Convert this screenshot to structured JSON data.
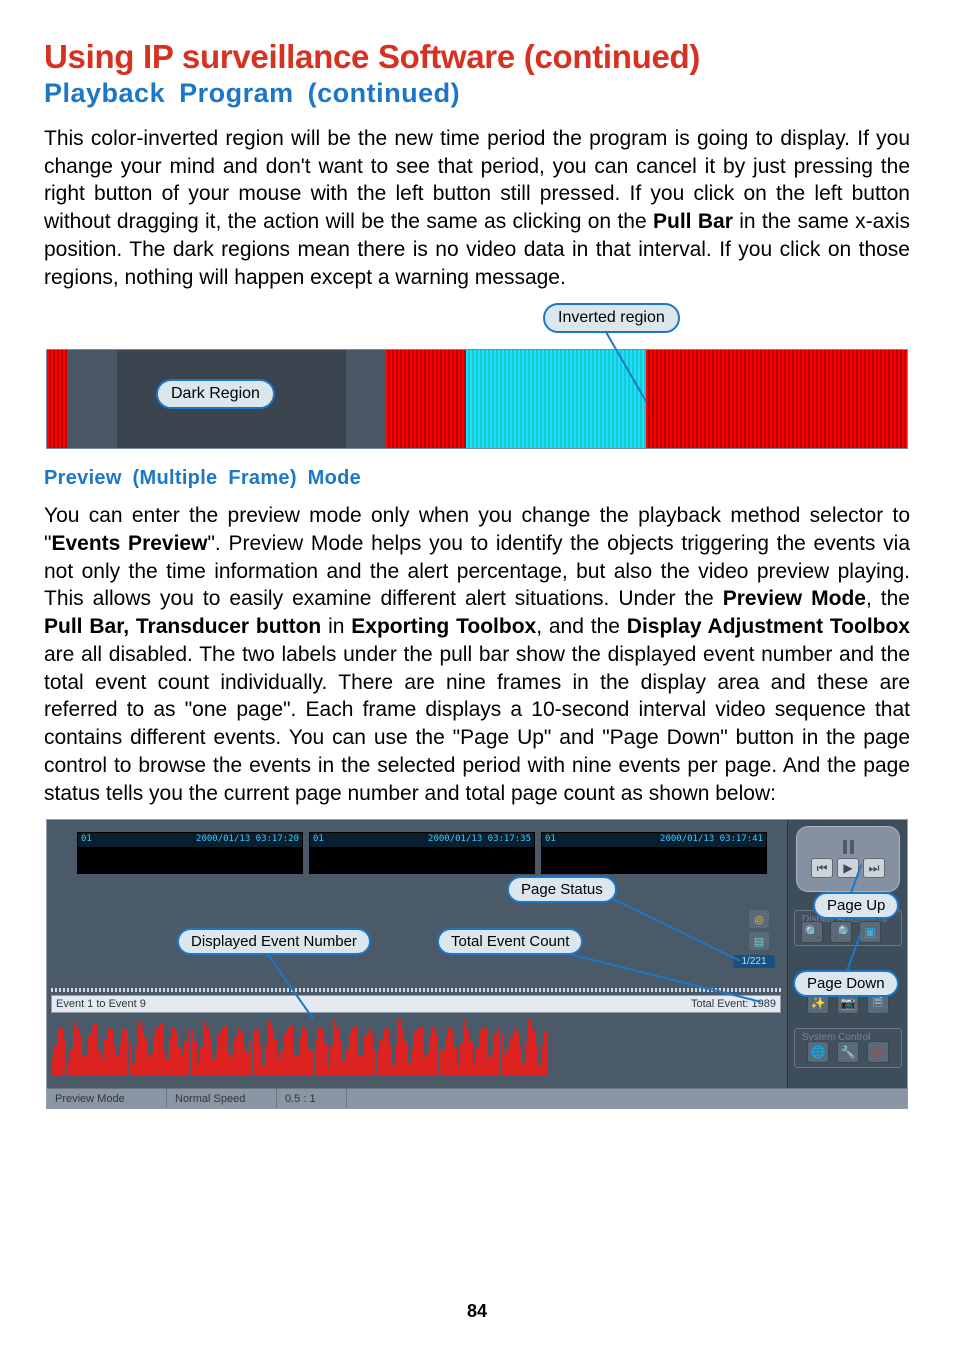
{
  "title": "Using IP surveillance Software (continued)",
  "subtitle": "Playback Program (continued)",
  "para1_a": "This color-inverted region will be the new time period the program is going to display. If you change your mind and don't want to see that period, you can cancel it by just pressing the right button of your mouse with the left button still pressed. If you click on the left button without dragging it, the action will be the same as clicking on the ",
  "para1_b": "Pull Bar",
  "para1_c": " in the same x-axis position. The dark regions mean there is no video data in that interval. If you click on those regions, nothing will happen except a warning message.",
  "callouts": {
    "inverted_region": "Inverted region",
    "dark_region": "Dark Region",
    "page_status": "Page Status",
    "displayed_event_number": "Displayed Event Number",
    "total_event_count": "Total Event Count",
    "page_up": "Page Up",
    "page_down": "Page Down"
  },
  "section_heading": "Preview (Multiple Frame) Mode",
  "para2_a": "You can enter the preview mode only when you change the playback method selector to \"",
  "para2_b": "Events Preview",
  "para2_c": "\". Preview Mode helps you to identify the objects triggering the events via not only the time information and the alert percentage, but also the video preview playing. This allows you to easily examine different alert situations. Under the ",
  "para2_d": "Preview Mode",
  "para2_e": ", the ",
  "para2_f": "Pull Bar, Transducer button",
  "para2_g": " in ",
  "para2_h": "Exporting Toolbox",
  "para2_i": ", and the ",
  "para2_j": "Display Adjustment Toolbox",
  "para2_k": " are all disabled. The two labels under the pull bar show the displayed event number and the total event count individually. There are nine frames in the display area and these are referred to as \"one page\". Each frame displays a 10-second interval video sequence that contains different events. You can use the \"Page Up\" and \"Page Down\" button in the page control to browse the events in the selected period with nine events per page. And the page status tells you the current page number and total page count as shown below:",
  "frames": {
    "ch": "01",
    "ts1": "2000/01/13 03:17:20",
    "ts2": "2000/01/13 03:17:35",
    "ts3": "2000/01/13 03:17:41"
  },
  "right_panel": {
    "display_adjustment": "Display Adjustment",
    "system_control": "System Control"
  },
  "page_status_value": "1/221",
  "event_strip_left": "Event 1 to Event 9",
  "event_strip_right": "Total Event: 1989",
  "status_bar": {
    "mode": "Preview Mode",
    "speed": "Normal Speed",
    "zoom": "0.5 : 1"
  },
  "page_number": "84"
}
